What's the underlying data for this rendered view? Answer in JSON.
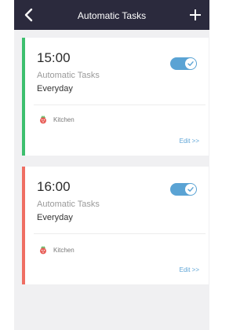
{
  "header": {
    "title": "Automatic Tasks",
    "back_icon": "chevron-left-icon",
    "add_icon": "plus-icon"
  },
  "colors": {
    "header_bg": "#2b2a3d",
    "toggle_on": "#5aa3d4",
    "task1_stripe": "#3dbf6e",
    "task2_stripe": "#ef6e63",
    "edit_link": "#5fa5d6"
  },
  "tasks": [
    {
      "time": "15:00",
      "label": "Automatic Tasks",
      "repeat": "Everyday",
      "enabled": true,
      "room": "Kitchen",
      "room_icon": "kitchen-icon",
      "edit_label": "Edit >>"
    },
    {
      "time": "16:00",
      "label": "Automatic Tasks",
      "repeat": "Everyday",
      "enabled": true,
      "room": "Kitchen",
      "room_icon": "kitchen-icon",
      "edit_label": "Edit >>"
    }
  ]
}
